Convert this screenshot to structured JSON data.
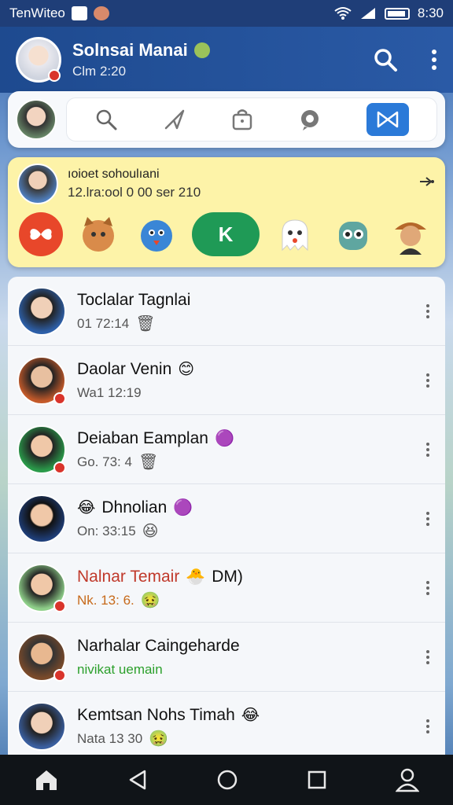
{
  "status_bar": {
    "left_text": "TenWiteo",
    "time": "8:30"
  },
  "header": {
    "title": "Solnsai Manai",
    "subtitle": "Clm 2:20",
    "search_icon": "search-icon",
    "more_icon": "more-vert-icon"
  },
  "search_toolbar": {
    "icons": [
      "search-icon",
      "send-icon",
      "bag-icon",
      "chat-icon",
      "bowtie-icon"
    ],
    "active_icon": "bowtie-icon"
  },
  "story": {
    "name": "ıoioet sohoulıani",
    "time": "12.lra:ool 0 00 ser 210",
    "action_icon": "share-icon",
    "stickers": [
      "heart-sticker",
      "cat-sticker",
      "bird-sticker",
      "k-sticker",
      "ghost-sticker",
      "owl-sticker",
      "girl-sticker"
    ],
    "k_label": "K"
  },
  "chats": [
    {
      "name": "Toclalar Tagnlai",
      "sub": "01 72:14",
      "name_emoji": "",
      "sub_emoji": "🗑",
      "avatar_color": "#2d5fa8"
    },
    {
      "name": "Daolar Venin",
      "sub": "Wa1 12:19",
      "name_emoji": "😊",
      "sub_emoji": "",
      "avatar_color": "#c45a2a"
    },
    {
      "name": "Deiaban Eamplan",
      "sub": "Go. 73: 4",
      "name_emoji": "🟣",
      "sub_emoji": "🗑",
      "avatar_color": "#2a9a4a"
    },
    {
      "name": "Dhnolian",
      "sub": "On: 33:15",
      "name_emoji": "🟣",
      "sub_emoji": "😆",
      "lead_emoji": "😂",
      "avatar_color": "#1f3f7a"
    },
    {
      "name": "Nalnar Temair",
      "name_suffix": "DM)",
      "sub": "Nk. 13: 6.",
      "name_emoji": "🐣",
      "sub_emoji": "🤢",
      "avatar_color": "#8fd08a"
    },
    {
      "name": "Narhalar Caingeharde",
      "sub": "nivikat uemain",
      "name_emoji": "",
      "sub_emoji": "",
      "avatar_color": "#7a4a2a"
    },
    {
      "name": "Kemtsan Nohs Timah",
      "sub": "Nata 13 30",
      "name_emoji": "😂",
      "sub_emoji": "🤢",
      "avatar_color": "#3a5fa0"
    }
  ],
  "nav": {
    "icons": [
      "home-icon",
      "back-icon",
      "home-circle-icon",
      "recents-icon",
      "profile-icon"
    ]
  }
}
